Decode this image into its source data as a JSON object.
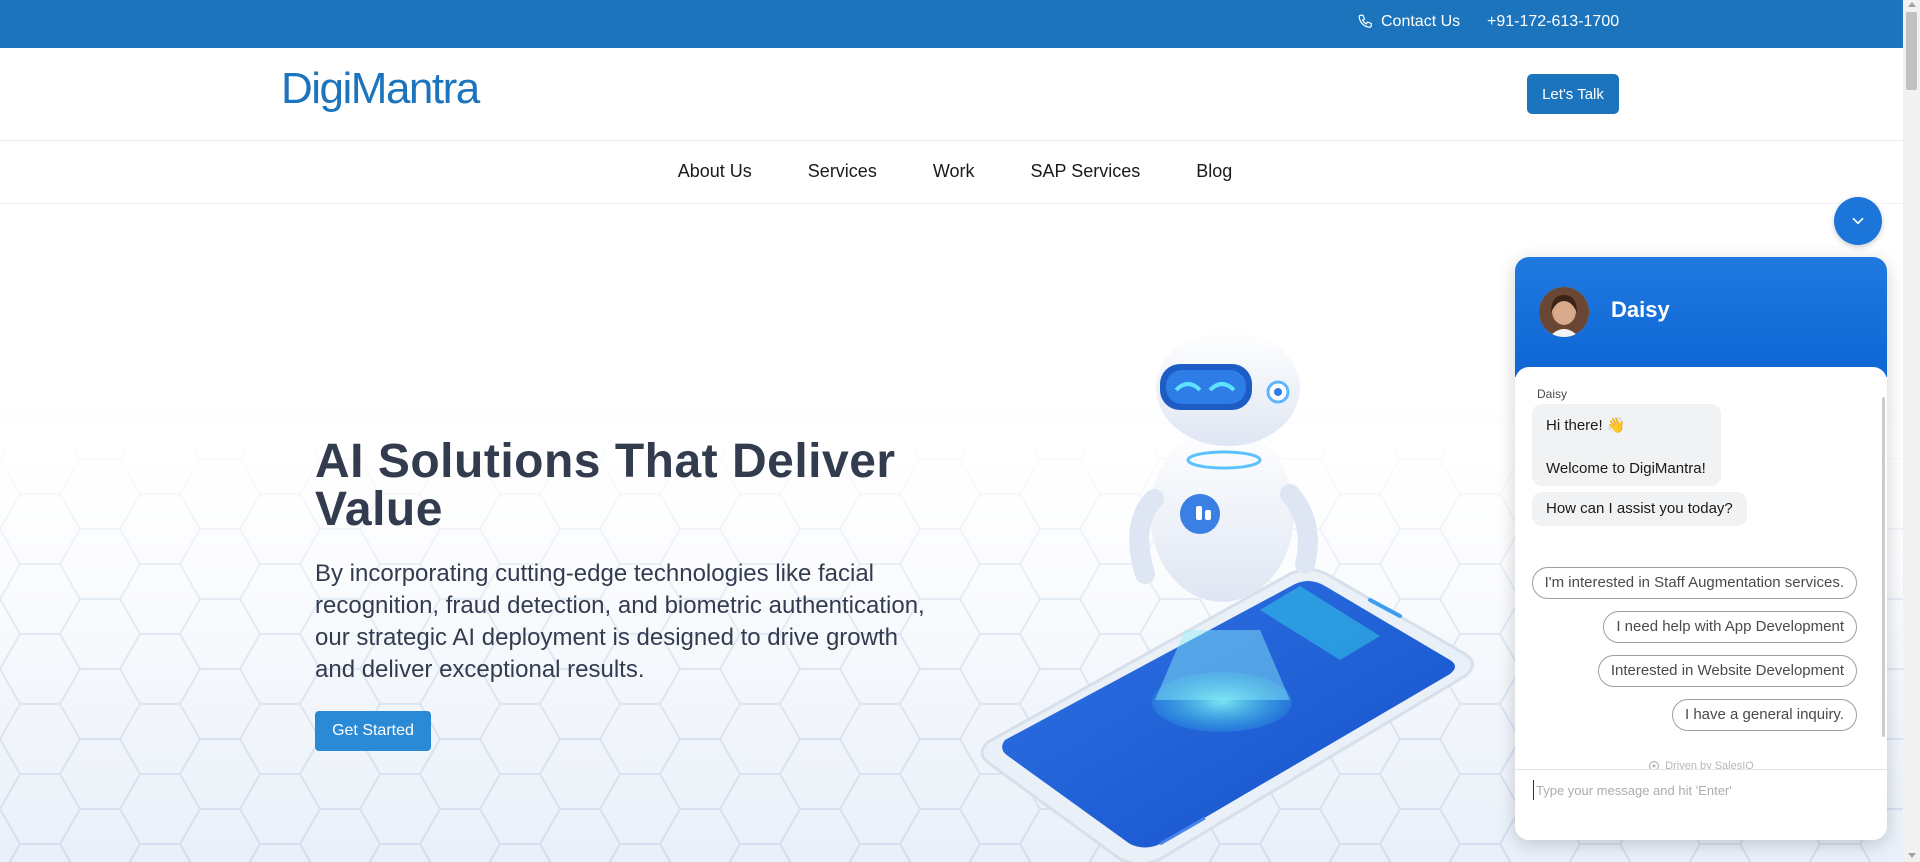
{
  "topbar": {
    "contact_label": "Contact Us",
    "phone": "+91-172-613-1700"
  },
  "header": {
    "logo_text": "DigiMantra",
    "cta_label": "Let's Talk"
  },
  "nav": {
    "items": [
      "About Us",
      "Services",
      "Work",
      "SAP Services",
      "Blog"
    ]
  },
  "hero": {
    "title": "AI Solutions That Deliver Value",
    "description": "By incorporating cutting-edge technologies like facial recognition, fraud detection, and biometric authentication, our strategic AI deployment is designed to drive growth and deliver exceptional results.",
    "cta_label": "Get Started"
  },
  "chat": {
    "agent_name": "Daisy",
    "sender_label": "Daisy",
    "greeting": "Hi there! 👋",
    "welcome": "Welcome to DigiMantra!",
    "question": "How can I assist you today?",
    "options": [
      "I'm interested in Staff Augmentation services.",
      "I need help with App Development",
      "Interested in Website Development",
      "I have a general inquiry."
    ],
    "driven_by": "Driven by SalesIQ",
    "input_placeholder": "Type your message and hit 'Enter'"
  },
  "colors": {
    "brand_blue": "#1c75bc",
    "cta_blue": "#2b8ad6",
    "chat_blue": "#1c75d8",
    "text_dark": "#333b4f"
  }
}
